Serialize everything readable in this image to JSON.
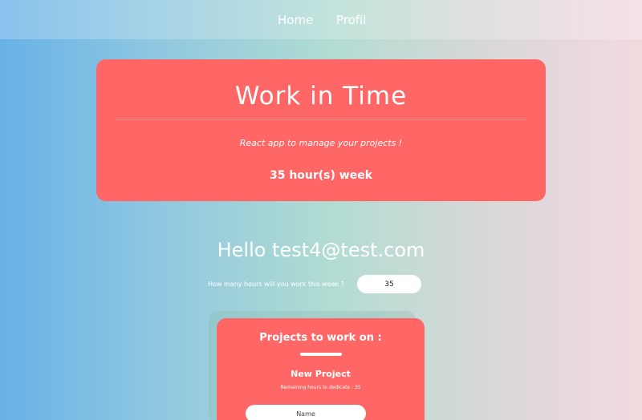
{
  "nav": {
    "home_label": "Home",
    "profil_label": "Profil"
  },
  "hero": {
    "title": "Work in Time",
    "subtitle": "React app to manage your projects !",
    "hours_text": "35 hour(s) week"
  },
  "greeting": {
    "text": "Hello test4@test.com"
  },
  "hours_form": {
    "label": "How many hours will you work this week ?",
    "value": "35"
  },
  "projects": {
    "title": "Projects to work on :",
    "new_project_title": "New Project",
    "remaining_text": "Remaining hours to dedicate : 35",
    "name_placeholder": "Name"
  },
  "colors": {
    "accent": "#ff6666",
    "text": "#ffffff"
  }
}
